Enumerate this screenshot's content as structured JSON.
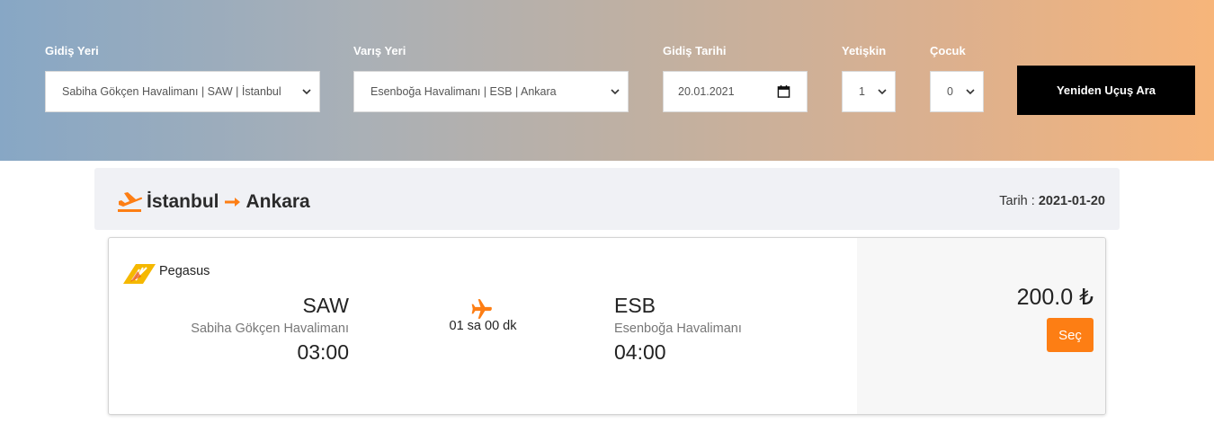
{
  "search": {
    "origin_label": "Gidiş Yeri",
    "origin_value": "Sabiha Gökçen Havalimanı | SAW | İstanbul",
    "destination_label": "Varış Yeri",
    "destination_value": "Esenboğa Havalimanı | ESB | Ankara",
    "date_label": "Gidiş Tarihi",
    "date_value": "20.01.2021",
    "adult_label": "Yetişkin",
    "adult_value": "1",
    "child_label": "Çocuk",
    "child_value": "0",
    "button_label": "Yeniden Uçuş Ara"
  },
  "route": {
    "from_city": "İstanbul",
    "to_city": "Ankara",
    "date_label": "Tarih :",
    "date_value": "2021-01-20"
  },
  "flight": {
    "airline": "Pegasus",
    "dep_code": "SAW",
    "dep_airport": "Sabiha Gökçen Havalimanı",
    "dep_time": "03:00",
    "duration": "01 sa 00 dk",
    "arr_code": "ESB",
    "arr_airport": "Esenboğa Havalimanı",
    "arr_time": "04:00",
    "price": "200.0 ₺",
    "select_label": "Seç"
  },
  "colors": {
    "accent": "#fd7e14",
    "gradient_start": "#87a7c5",
    "gradient_end": "#f7b57a",
    "search_button": "#000000"
  },
  "icons": {
    "route": "plane-takeoff-icon",
    "arrow": "arrow-right-icon",
    "flight": "plane-icon",
    "airline": "pegasus-logo",
    "select": "chevron-down-icon",
    "date": "calendar-icon"
  }
}
